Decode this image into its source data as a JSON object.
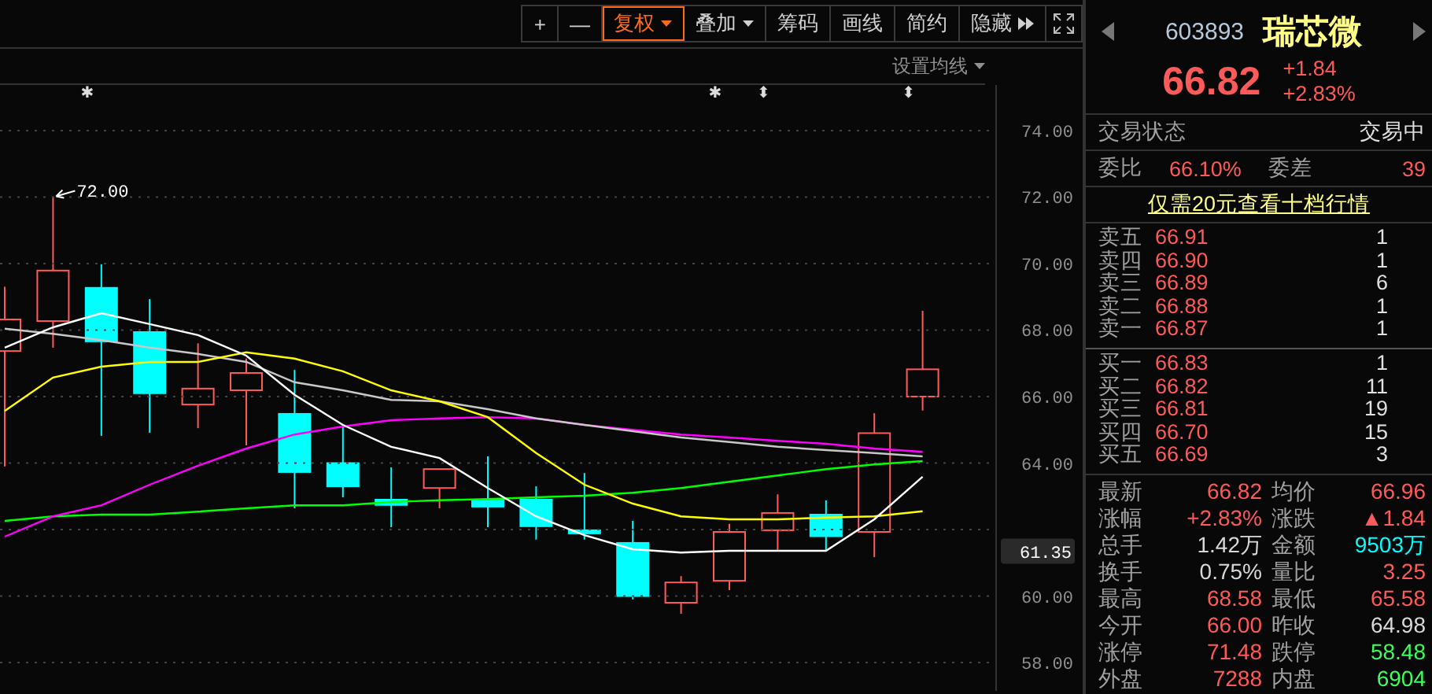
{
  "toolbar": {
    "buttons": [
      {
        "label": "+",
        "kind": "plain",
        "selected": false
      },
      {
        "label": "—",
        "kind": "plain",
        "selected": false
      },
      {
        "label": "复权",
        "kind": "dropdown",
        "selected": true
      },
      {
        "label": "叠加",
        "kind": "dropdown",
        "selected": false
      },
      {
        "label": "筹码",
        "kind": "plain",
        "selected": false
      },
      {
        "label": "画线",
        "kind": "plain",
        "selected": false
      },
      {
        "label": "简约",
        "kind": "plain",
        "selected": false
      },
      {
        "label": "隐藏",
        "kind": "more",
        "selected": false
      }
    ]
  },
  "ma_settings": {
    "label": "设置均线"
  },
  "chart": {
    "price_tag": "61.35",
    "chart_data": {
      "type": "line",
      "ylim": [
        57.15,
        75.37
      ],
      "grid": true,
      "yticks": [
        {
          "value": 74,
          "label": "74.00"
        },
        {
          "value": 72,
          "label": "72.00"
        },
        {
          "value": 70,
          "label": "70.00"
        },
        {
          "value": 68,
          "label": "68.00"
        },
        {
          "value": 66,
          "label": "66.00"
        },
        {
          "value": 64,
          "label": "64.00"
        },
        {
          "value": 60,
          "label": "60.00"
        },
        {
          "value": 58,
          "label": "58.00"
        }
      ],
      "series": [
        {
          "color": "#00ff00",
          "values": [
            62.26,
            62.4,
            62.45,
            62.45,
            62.54,
            62.64,
            62.73,
            62.73,
            62.83,
            62.88,
            62.92,
            62.97,
            63.02,
            63.11,
            63.25,
            63.44,
            63.63,
            63.82,
            63.96,
            64.06
          ]
        },
        {
          "color": "#ff00ff",
          "values": [
            61.79,
            62.4,
            62.73,
            63.35,
            63.92,
            64.44,
            64.86,
            65.1,
            65.29,
            65.34,
            65.38,
            65.34,
            65.15,
            65.0,
            64.86,
            64.77,
            64.67,
            64.58,
            64.44,
            64.34
          ]
        },
        {
          "color": "#c8c8c8",
          "values": [
            68.04,
            67.89,
            67.7,
            67.47,
            67.28,
            67.04,
            66.43,
            66.19,
            65.9,
            65.86,
            65.62,
            65.34,
            65.15,
            64.96,
            64.77,
            64.63,
            64.49,
            64.39,
            64.3,
            64.2
          ]
        },
        {
          "color": "#ffff00",
          "values": [
            65.57,
            66.57,
            66.9,
            67.04,
            67.04,
            67.33,
            67.14,
            66.76,
            66.19,
            65.86,
            65.38,
            64.3,
            63.35,
            62.78,
            62.4,
            62.31,
            62.31,
            62.36,
            62.4,
            62.55
          ]
        },
        {
          "color": "#ffffff",
          "values": [
            67.47,
            68.08,
            68.51,
            68.18,
            67.85,
            67.23,
            66.05,
            65.15,
            64.49,
            64.15,
            63.25,
            62.4,
            61.83,
            61.41,
            61.31,
            61.36,
            61.36,
            61.36,
            62.31,
            63.59
          ]
        }
      ],
      "annotations": [
        {
          "text": "72.00"
        },
        {
          "text": "✱"
        },
        {
          "text": "✱"
        },
        {
          "text": "⬍"
        },
        {
          "text": "⬍"
        }
      ]
    }
  },
  "quote": {
    "code": "603893",
    "name": "瑞芯微",
    "price": "66.82",
    "change": "+1.84",
    "change_pct": "+2.83%"
  },
  "status": {
    "label": "交易状态",
    "value": "交易中"
  },
  "order_ratio": {
    "label": "委比",
    "value": "66.10%",
    "diff_label": "委差",
    "diff_value": "39"
  },
  "promo_link": "仅需20元查看十档行情",
  "asks": [
    {
      "label": "卖五",
      "price": "66.91",
      "volume": "1"
    },
    {
      "label": "卖四",
      "price": "66.90",
      "volume": "1"
    },
    {
      "label": "卖三",
      "price": "66.89",
      "volume": "6"
    },
    {
      "label": "卖二",
      "price": "66.88",
      "volume": "1"
    },
    {
      "label": "卖一",
      "price": "66.87",
      "volume": "1"
    }
  ],
  "bids": [
    {
      "label": "买一",
      "price": "66.83",
      "volume": "1"
    },
    {
      "label": "买二",
      "price": "66.82",
      "volume": "11"
    },
    {
      "label": "买三",
      "price": "66.81",
      "volume": "19"
    },
    {
      "label": "买四",
      "price": "66.70",
      "volume": "15"
    },
    {
      "label": "买五",
      "price": "66.69",
      "volume": "3"
    }
  ],
  "stats": [
    {
      "label": "最新",
      "value": "66.82",
      "color": "#ff5a5a"
    },
    {
      "label": "均价",
      "value": "66.96",
      "color": "#ff5a5a"
    },
    {
      "label": "涨幅",
      "value": "+2.83%",
      "color": "#ff5a5a"
    },
    {
      "label": "涨跌",
      "value": "▲1.84",
      "color": "#ff5a5a"
    },
    {
      "label": "总手",
      "value": "1.42万",
      "color": "#d8d8d8"
    },
    {
      "label": "金额",
      "value": "9503万",
      "color": "#00ffff"
    },
    {
      "label": "换手",
      "value": "0.75%",
      "color": "#d8d8d8"
    },
    {
      "label": "量比",
      "value": "3.25",
      "color": "#ff5a5a"
    },
    {
      "label": "最高",
      "value": "68.58",
      "color": "#ff5a5a"
    },
    {
      "label": "最低",
      "value": "65.58",
      "color": "#ff5a5a"
    },
    {
      "label": "今开",
      "value": "66.00",
      "color": "#ff5a5a"
    },
    {
      "label": "昨收",
      "value": "64.98",
      "color": "#d8d8d8"
    },
    {
      "label": "涨停",
      "value": "71.48",
      "color": "#ff5a5a"
    },
    {
      "label": "跌停",
      "value": "58.48",
      "color": "#3cff5a"
    },
    {
      "label": "外盘",
      "value": "7288",
      "color": "#ff5a5a"
    },
    {
      "label": "内盘",
      "value": "6904",
      "color": "#3cff5a"
    }
  ]
}
